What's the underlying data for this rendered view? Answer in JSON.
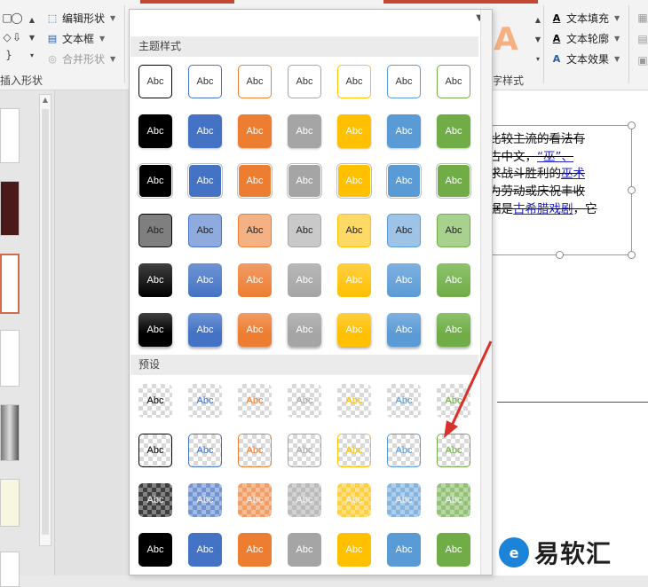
{
  "ribbon": {
    "insert_shapes_label": "插入形状",
    "edit_shape": "编辑形状",
    "text_box": "文本框",
    "merge_shapes": "合并形状",
    "text_fill": "文本填充",
    "text_outline": "文本轮廓",
    "text_effects": "文本效果",
    "art_style_label": "艺术字样式",
    "wordart_glyph": "A"
  },
  "panel": {
    "section_theme": "主题样式",
    "section_preset": "预设",
    "swatch_text": "Abc",
    "colors": [
      "#000000",
      "#4472c4",
      "#ed7d31",
      "#a5a5a5",
      "#ffc000",
      "#5b9bd5",
      "#70ad47"
    ]
  },
  "slide": {
    "lines": [
      {
        "pre": "",
        "main": "比较主流的看法有",
        "link": "",
        "post": ""
      },
      {
        "pre": "",
        "main": "古中文，",
        "link": "“巫”、",
        "post": ""
      },
      {
        "pre": "",
        "main": "求战斗胜利的",
        "link": "巫术",
        "post": ""
      },
      {
        "pre": "",
        "main": "为劳动或庆祝丰收",
        "link": "",
        "post": ""
      },
      {
        "pre": "",
        "main": "据是",
        "link": "古希腊戏剧",
        "post": "，它"
      }
    ]
  },
  "watermark": {
    "logo": "e",
    "text": "易软汇"
  }
}
